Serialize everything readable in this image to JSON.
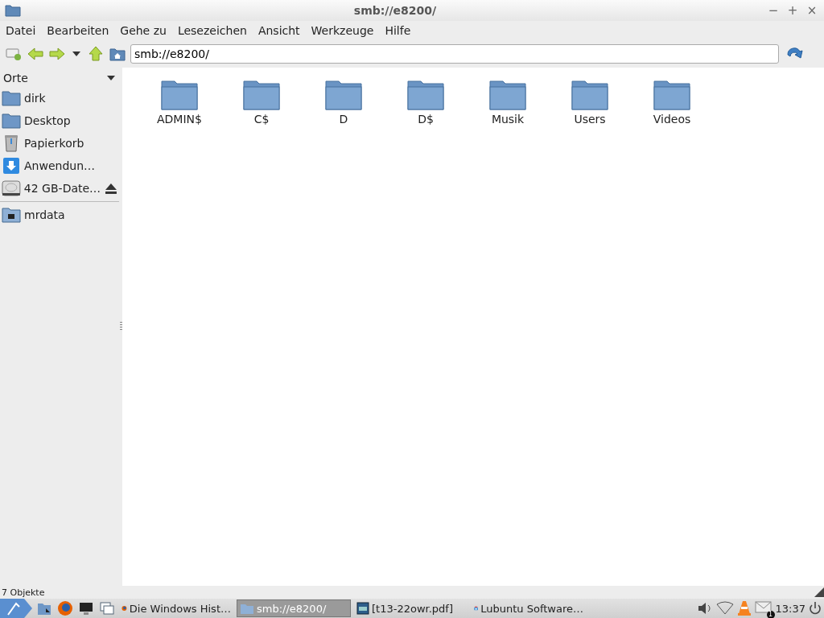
{
  "window": {
    "title": "smb://e8200/",
    "controls": [
      "−",
      "+",
      "×"
    ]
  },
  "menu": [
    "Datei",
    "Bearbeiten",
    "Gehe zu",
    "Lesezeichen",
    "Ansicht",
    "Werkzeuge",
    "Hilfe"
  ],
  "location": {
    "value": "smb://e8200/"
  },
  "sidebar": {
    "title": "Orte",
    "places": [
      {
        "label": "dirk",
        "kind": "folder"
      },
      {
        "label": "Desktop",
        "kind": "folder"
      },
      {
        "label": "Papierkorb",
        "kind": "trash"
      },
      {
        "label": "Anwendun…",
        "kind": "apps"
      },
      {
        "label": "42 GB-Date…",
        "kind": "drive"
      }
    ],
    "bookmarks": [
      {
        "label": "mrdata",
        "kind": "share"
      }
    ]
  },
  "files": [
    "ADMIN$",
    "C$",
    "D",
    "D$",
    "Musik",
    "Users",
    "Videos"
  ],
  "status_bar": "7 Objekte",
  "taskbar": {
    "tasks": [
      {
        "label": "Die Windows Hist…",
        "kind": "browser",
        "selected": false
      },
      {
        "label": "smb://e8200/",
        "kind": "folder",
        "selected": true
      },
      {
        "label": "[t13-22owr.pdf]",
        "kind": "document",
        "selected": false
      },
      {
        "label": "Lubuntu Software…",
        "kind": "store",
        "selected": false
      }
    ],
    "mail_count": "1",
    "clock": "13:37"
  }
}
